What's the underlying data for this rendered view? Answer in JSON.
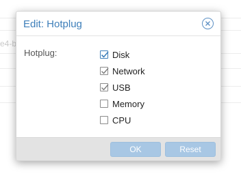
{
  "background": {
    "partial_text": "e4-b"
  },
  "dialog": {
    "title": "Edit: Hotplug",
    "field_label": "Hotplug:",
    "options": [
      {
        "label": "Disk",
        "checked": true
      },
      {
        "label": "Network",
        "checked": true
      },
      {
        "label": "USB",
        "checked": true
      },
      {
        "label": "Memory",
        "checked": false
      },
      {
        "label": "CPU",
        "checked": false
      }
    ],
    "buttons": {
      "ok_label": "OK",
      "reset_label": "Reset"
    }
  },
  "colors": {
    "accent": "#3d7eb9",
    "button_disabled": "#a8c7e4",
    "footer_bg": "#e3e3e3"
  },
  "icons": {
    "close": "close-circle-icon",
    "check": "check-icon"
  }
}
